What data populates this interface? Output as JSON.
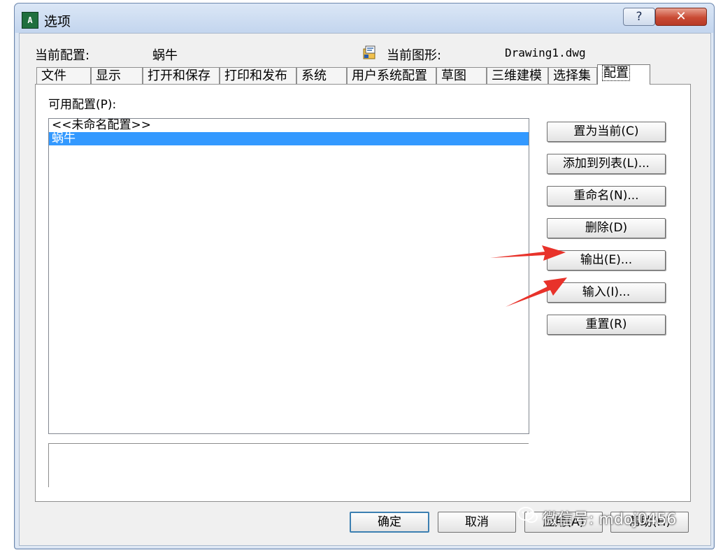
{
  "window": {
    "title": "选项",
    "help_label": "?",
    "close_label": "✕"
  },
  "header": {
    "profile_label": "当前配置:",
    "profile_value": "蜗牛",
    "drawing_label": "当前图形:",
    "drawing_value": "Drawing1.dwg"
  },
  "tabs": [
    {
      "label": "文件"
    },
    {
      "label": "显示"
    },
    {
      "label": "打开和保存"
    },
    {
      "label": "打印和发布"
    },
    {
      "label": "系统"
    },
    {
      "label": "用户系统配置"
    },
    {
      "label": "草图"
    },
    {
      "label": "三维建模"
    },
    {
      "label": "选择集"
    },
    {
      "label": "配置",
      "active": true
    }
  ],
  "profiles": {
    "label": "可用配置(P):",
    "items": [
      "<<未命名配置>>",
      "蜗牛"
    ],
    "selected": "蜗牛"
  },
  "side_buttons": {
    "set_current": "置为当前(C)",
    "add_to_list": "添加到列表(L)...",
    "rename": "重命名(N)...",
    "delete": "删除(D)",
    "export": "输出(E)...",
    "import": "输入(I)...",
    "reset": "重置(R)"
  },
  "footer": {
    "ok": "确定",
    "cancel": "取消",
    "apply": "应用(A)",
    "help": "帮助(H)"
  },
  "watermark": "微信号: mdoj0456",
  "colors": {
    "selection": "#3399ff",
    "arrow": "#e8322a",
    "window_frame": "#c3d5ee"
  }
}
